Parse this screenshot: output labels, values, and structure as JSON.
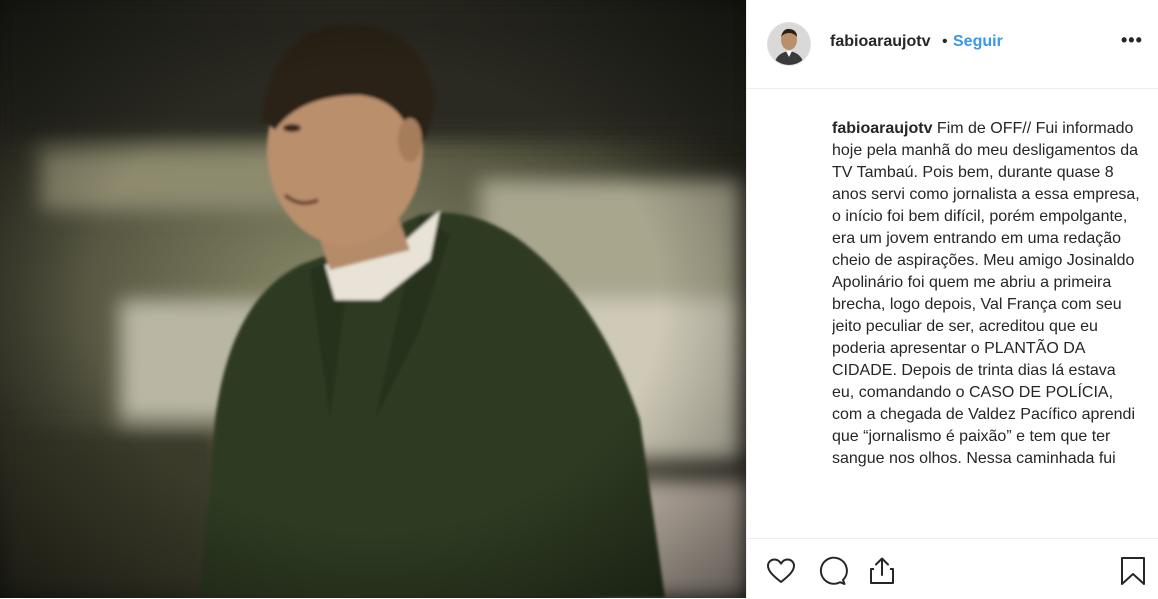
{
  "post": {
    "image_alt": "Young man in a dark green suit jacket and white shirt smiling, sepia-toned blurred background",
    "header": {
      "username": "fabioaraujotv",
      "separator": "•",
      "follow_label": "Seguir",
      "more_label": "•••"
    },
    "caption": {
      "username": "fabioaraujotv",
      "text": "Fim de OFF// Fui informado hoje pela manhã do meu desligamentos da TV Tambaú. Pois bem, durante quase 8 anos servi como jornalista a essa empresa, o início foi bem difícil, porém empolgante, era um jovem entrando em uma redação cheio de aspirações. Meu amigo Josinaldo Apolinário foi quem me abriu a primeira brecha, logo depois, Val França com seu jeito peculiar de ser, acreditou que eu poderia apresentar o PLANTÃO DA CIDADE. Depois de trinta dias lá estava eu, comandando o CASO DE POLÍCIA, com a chegada de Valdez Pacífico aprendi que “jornalismo é paixão” e tem que ter sangue nos olhos. Nessa caminhada fui"
    },
    "actions": {
      "like_icon": "heart-icon",
      "comment_icon": "comment-icon",
      "share_icon": "share-icon",
      "save_icon": "bookmark-icon"
    }
  }
}
